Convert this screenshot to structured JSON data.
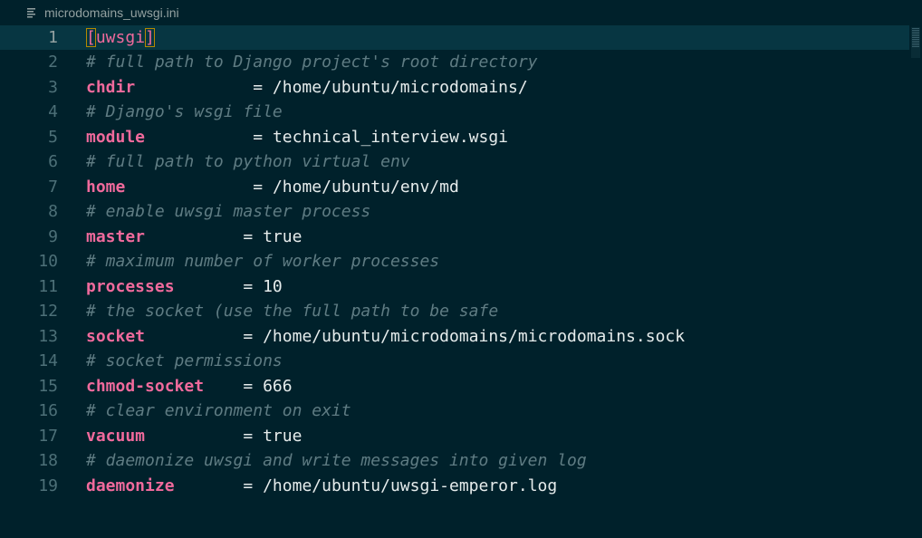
{
  "tab": {
    "title": "microdomains_uwsgi.ini",
    "icon": "file-lines-icon"
  },
  "colors": {
    "background": "#00212b",
    "current_line": "#073642",
    "key": "#f06a9c",
    "comment": "#5f7c83",
    "value": "#e6ecec",
    "bracket_outline": "#b58900"
  },
  "editor": {
    "current_line": 1,
    "lines": [
      {
        "num": "1",
        "type": "section",
        "open": "[",
        "text": "uwsgi",
        "close": "]"
      },
      {
        "num": "2",
        "type": "comment",
        "text": "# full path to Django project's root directory"
      },
      {
        "num": "3",
        "type": "kv",
        "key": "chdir",
        "pad": "            ",
        "eq": "= ",
        "value": "/home/ubuntu/microdomains/"
      },
      {
        "num": "4",
        "type": "comment",
        "text": "# Django's wsgi file"
      },
      {
        "num": "5",
        "type": "kv",
        "key": "module",
        "pad": "           ",
        "eq": "= ",
        "value": "technical_interview.wsgi"
      },
      {
        "num": "6",
        "type": "comment",
        "text": "# full path to python virtual env"
      },
      {
        "num": "7",
        "type": "kv",
        "key": "home",
        "pad": "             ",
        "eq": "= ",
        "value": "/home/ubuntu/env/md"
      },
      {
        "num": "8",
        "type": "comment",
        "text": "# enable uwsgi master process"
      },
      {
        "num": "9",
        "type": "kv",
        "key": "master",
        "pad": "          ",
        "eq": "= ",
        "value": "true"
      },
      {
        "num": "10",
        "type": "comment",
        "text": "# maximum number of worker processes"
      },
      {
        "num": "11",
        "type": "kv",
        "key": "processes",
        "pad": "       ",
        "eq": "= ",
        "value": "10"
      },
      {
        "num": "12",
        "type": "comment",
        "text": "# the socket (use the full path to be safe"
      },
      {
        "num": "13",
        "type": "kv",
        "key": "socket",
        "pad": "          ",
        "eq": "= ",
        "value": "/home/ubuntu/microdomains/microdomains.sock"
      },
      {
        "num": "14",
        "type": "comment",
        "text": "# socket permissions"
      },
      {
        "num": "15",
        "type": "kv",
        "key": "chmod-socket",
        "pad": "    ",
        "eq": "= ",
        "value": "666"
      },
      {
        "num": "16",
        "type": "comment",
        "text": "# clear environment on exit"
      },
      {
        "num": "17",
        "type": "kv",
        "key": "vacuum",
        "pad": "          ",
        "eq": "= ",
        "value": "true"
      },
      {
        "num": "18",
        "type": "comment",
        "text": "# daemonize uwsgi and write messages into given log"
      },
      {
        "num": "19",
        "type": "kv",
        "key": "daemonize",
        "pad": "       ",
        "eq": "= ",
        "value": "/home/ubuntu/uwsgi-emperor.log"
      }
    ]
  }
}
